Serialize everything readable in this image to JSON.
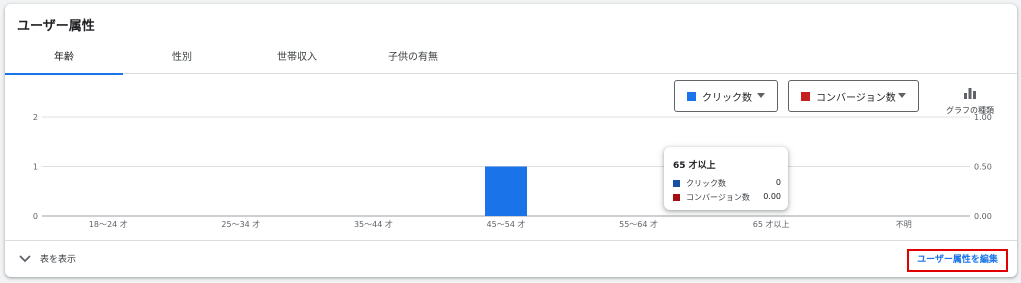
{
  "card": {
    "title": "ユーザー属性"
  },
  "tabs": [
    {
      "label": "年齢",
      "active": true
    },
    {
      "label": "性別",
      "active": false
    },
    {
      "label": "世帯収入",
      "active": false
    },
    {
      "label": "子供の有無",
      "active": false
    }
  ],
  "metrics": {
    "primary": {
      "label": "クリック数",
      "color": "#1a73e8"
    },
    "secondary": {
      "label": "コンバージョン数",
      "color": "#c5221f"
    }
  },
  "chart_type_button": {
    "label": "グラフの種類",
    "icon": "bar-chart-icon"
  },
  "chart_data": {
    "type": "bar",
    "categories": [
      "18〜24 才",
      "25〜34 才",
      "35〜44 才",
      "45〜54 才",
      "55〜64 才",
      "65 才以上",
      "不明"
    ],
    "series": [
      {
        "name": "クリック数",
        "values": [
          0,
          0,
          0,
          1,
          0,
          0,
          0
        ],
        "axis": "left",
        "color": "#1a73e8"
      },
      {
        "name": "コンバージョン数",
        "values": [
          0,
          0,
          0,
          0,
          0,
          0,
          0
        ],
        "axis": "right",
        "color": "#c5221f"
      }
    ],
    "ylim": [
      0,
      2
    ],
    "y2lim": [
      0,
      1
    ],
    "yticks": [
      "0",
      "1",
      "2"
    ],
    "y2ticks": [
      "0.00",
      "0.50",
      "1.00"
    ],
    "grid": true
  },
  "tooltip": {
    "title": "65 才以上",
    "rows": [
      {
        "label": "クリック数",
        "value": "0",
        "color": "#174ea6"
      },
      {
        "label": "コンバージョン数",
        "value": "0.00",
        "color": "#a50e0e"
      }
    ]
  },
  "footer": {
    "show_table_label": "表を表示",
    "show_table_icon": "chevron-down-icon",
    "edit_label": "ユーザー属性を編集"
  }
}
